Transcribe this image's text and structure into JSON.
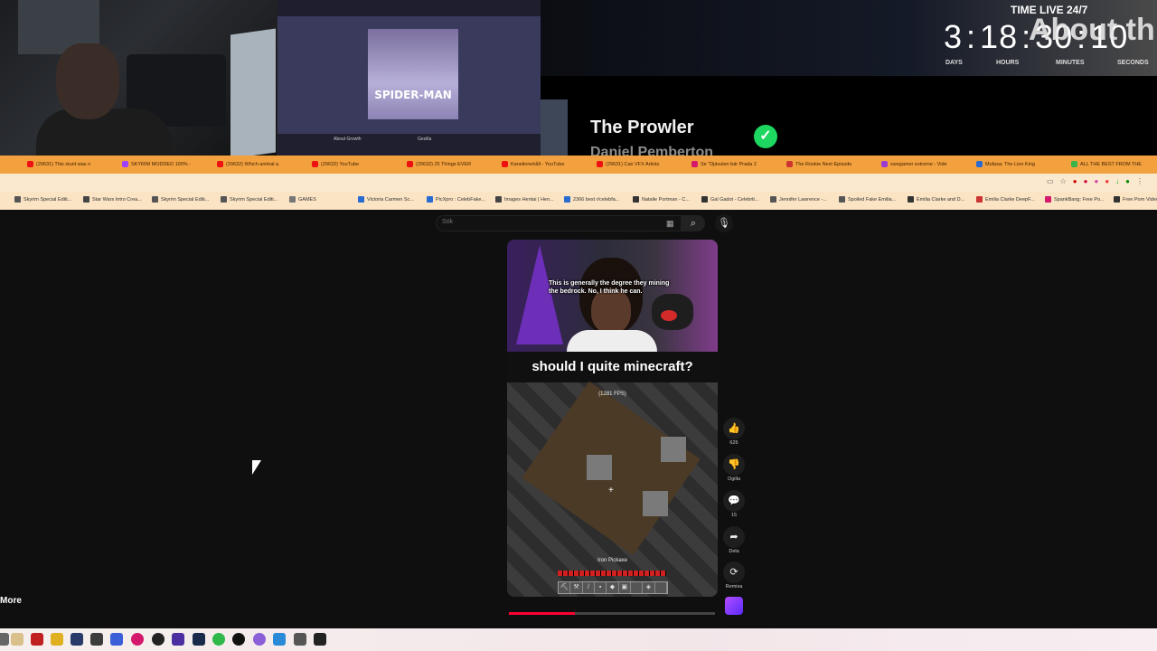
{
  "overlay": {
    "thumbnail_title": "SPIDER-MAN",
    "thumbnail_footer_left": "About Growth",
    "thumbnail_footer_mid": "Gezilla",
    "now_playing_title": "The Prowler",
    "now_playing_artist": "Daniel Pemberton",
    "timer_label": "TIME LIVE 24/7",
    "timer_days": "3",
    "timer_hours": "18",
    "timer_minutes": "30",
    "timer_seconds": "10",
    "timer_ghost_text": "About th",
    "unit_days": "DAYS",
    "unit_hours": "HOURS",
    "unit_minutes": "MINUTES",
    "unit_seconds": "SECONDS"
  },
  "tabs": [
    {
      "label": "(29631) This stunt was n",
      "color": "#e11"
    },
    {
      "label": "SKYRIM MODDED 100% -",
      "color": "#a040ff"
    },
    {
      "label": "(29632) Which animal a",
      "color": "#e11"
    },
    {
      "label": "(29632) YouTube",
      "color": "#e11"
    },
    {
      "label": "(29632) 25 Things EVER",
      "color": "#e11"
    },
    {
      "label": "Kanelinnehåll - YouTube",
      "color": "#e11"
    },
    {
      "label": "(29631) Can VFX Artists",
      "color": "#e11"
    },
    {
      "label": "Se \"Djävulen bär Prada 2",
      "color": "#d4186c"
    },
    {
      "label": "The Rookie Next Episode",
      "color": "#c33"
    },
    {
      "label": "swegamer extreme - Vide",
      "color": "#9b3cd1"
    },
    {
      "label": "Mufasa: The Lion King",
      "color": "#2a6bd1"
    },
    {
      "label": "ALL THE BEST FROM THE",
      "color": "#3ab34a"
    }
  ],
  "bookmarks": [
    {
      "label": "Skyrim Special Editi...",
      "color": "#555"
    },
    {
      "label": "Star Wars Intro Crea...",
      "color": "#444"
    },
    {
      "label": "Skyrim Special Editi...",
      "color": "#555"
    },
    {
      "label": "Skyrim Special Editi...",
      "color": "#555"
    },
    {
      "label": "GAMES",
      "color": "#777"
    },
    {
      "label": "Victoria Carmen Sc...",
      "color": "#2a6bd1"
    },
    {
      "label": "PicXpro : CelebFake...",
      "color": "#2a6bd1"
    },
    {
      "label": "Images Hentai | Hen...",
      "color": "#444"
    },
    {
      "label": "2366 best r/celebfa...",
      "color": "#2a6bd1"
    },
    {
      "label": "Natalie Portman - C...",
      "color": "#333"
    },
    {
      "label": "Gal Gadot - Celebrit...",
      "color": "#333"
    },
    {
      "label": "Jennifer Lawrence -...",
      "color": "#555"
    },
    {
      "label": "Spoiled Fake Emilia...",
      "color": "#555"
    },
    {
      "label": "Emilia Clarke and D...",
      "color": "#333"
    },
    {
      "label": "Emilia Clarke DeepF...",
      "color": "#c33"
    },
    {
      "label": "SpankBang: Free Po...",
      "color": "#d4186c"
    },
    {
      "label": "Free Porn Videos O...",
      "color": "#333"
    }
  ],
  "search": {
    "placeholder": "Sök"
  },
  "short": {
    "subtitle": "This is generally the degree they mining the bedrock. No, I think he can.",
    "caption": "should I quite minecraft?",
    "fps": "(1281 FPS)",
    "item_name": "Iron Pickaxe",
    "progress": 0.32
  },
  "actions": {
    "like_count": "625",
    "dislike_label": "Ogilla",
    "comment_count": "15",
    "share_label": "Dela",
    "remix_label": "Remixa"
  },
  "sidebar": {
    "more_label": "More"
  }
}
